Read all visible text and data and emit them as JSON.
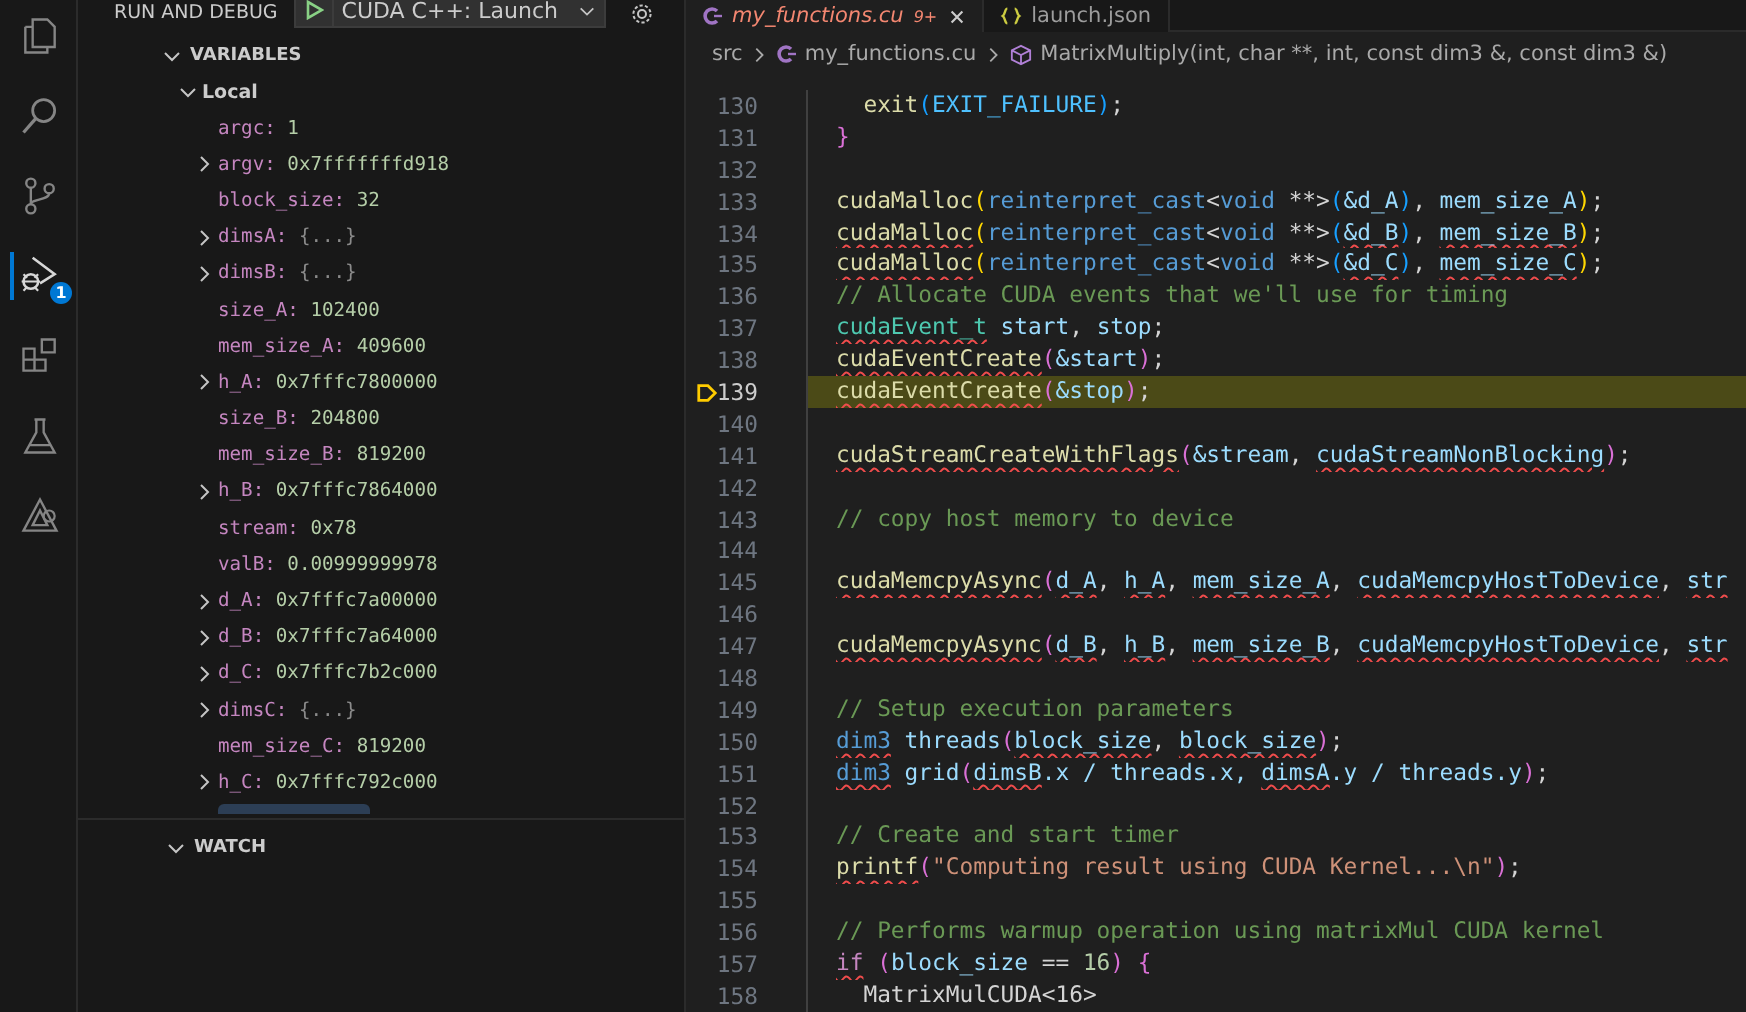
{
  "activity_bar": [
    {
      "kind": "files",
      "selected": false
    },
    {
      "kind": "search",
      "selected": false
    },
    {
      "kind": "source-control",
      "selected": false
    },
    {
      "kind": "debug",
      "selected": true,
      "badge": "1"
    },
    {
      "kind": "extensions",
      "selected": false
    },
    {
      "kind": "testing",
      "selected": false
    },
    {
      "kind": "cuda",
      "selected": false
    }
  ],
  "sidebar": {
    "title": "RUN AND DEBUG",
    "config": "CUDA C++: Launch",
    "variables": {
      "title": "VARIABLES",
      "expanded": true,
      "scope": {
        "label": "Local",
        "expanded": true,
        "items": [
          {
            "name": "argc:",
            "value": "1",
            "kind": "number",
            "expandable": false
          },
          {
            "name": "argv:",
            "value": "0x7fffffffd918",
            "kind": "number",
            "expandable": true
          },
          {
            "name": "block_size:",
            "value": "32",
            "kind": "number",
            "expandable": false
          },
          {
            "name": "dimsA:",
            "value": "{...}",
            "kind": "object",
            "expandable": true
          },
          {
            "name": "dimsB:",
            "value": "{...}",
            "kind": "object",
            "expandable": true
          },
          {
            "name": "size_A:",
            "value": "102400",
            "kind": "number",
            "expandable": false
          },
          {
            "name": "mem_size_A:",
            "value": "409600",
            "kind": "number",
            "expandable": false
          },
          {
            "name": "h_A:",
            "value": "0x7fffc7800000",
            "kind": "number",
            "expandable": true
          },
          {
            "name": "size_B:",
            "value": "204800",
            "kind": "number",
            "expandable": false
          },
          {
            "name": "mem_size_B:",
            "value": "819200",
            "kind": "number",
            "expandable": false
          },
          {
            "name": "h_B:",
            "value": "0x7fffc7864000",
            "kind": "number",
            "expandable": true
          },
          {
            "name": "stream:",
            "value": "0x78",
            "kind": "number",
            "expandable": false
          },
          {
            "name": "valB:",
            "value": "0.00999999978",
            "kind": "number",
            "expandable": false
          },
          {
            "name": "d_A:",
            "value": "0x7fffc7a00000",
            "kind": "number",
            "expandable": true
          },
          {
            "name": "d_B:",
            "value": "0x7fffc7a64000",
            "kind": "number",
            "expandable": true
          },
          {
            "name": "d_C:",
            "value": "0x7fffc7b2c000",
            "kind": "number",
            "expandable": true
          },
          {
            "name": "dimsC:",
            "value": "{...}",
            "kind": "object",
            "expandable": true
          },
          {
            "name": "mem_size_C:",
            "value": "819200",
            "kind": "number",
            "expandable": false
          },
          {
            "name": "h_C:",
            "value": "0x7fffc792c000",
            "kind": "number",
            "expandable": true
          }
        ]
      }
    },
    "watch": {
      "title": "WATCH",
      "expanded": true
    }
  },
  "tabs": [
    {
      "label": "my_functions.cu",
      "kind": "cpp",
      "selected": true,
      "problems": "9+"
    },
    {
      "label": "launch.json",
      "kind": "json",
      "selected": false
    }
  ],
  "breadcrumbs": [
    {
      "label": "src",
      "kind": "folder"
    },
    {
      "label": "my_functions.cu",
      "kind": "cpp"
    },
    {
      "label": "MatrixMultiply(int, char **, int, const dim3 &, const dim3 &)",
      "kind": "function"
    }
  ],
  "code": [
    {
      "number": "130",
      "current": false,
      "tokens": [
        {
          "kind": "fn",
          "text": "  exit",
          "error": false
        },
        {
          "kind": "b3",
          "text": "(",
          "error": false
        },
        {
          "kind": "const",
          "text": "EXIT_FAILURE",
          "error": false
        },
        {
          "kind": "b3",
          "text": ")",
          "error": false
        },
        {
          "kind": "plain",
          "text": ";",
          "error": false
        }
      ]
    },
    {
      "number": "131",
      "current": false,
      "tokens": [
        {
          "kind": "b2",
          "text": "}",
          "error": false
        }
      ]
    },
    {
      "number": "132",
      "current": false
    },
    {
      "number": "133",
      "current": false,
      "tokens": [
        {
          "kind": "fn",
          "text": "cudaMalloc",
          "error": false
        },
        {
          "kind": "b1",
          "text": "(",
          "error": false
        },
        {
          "kind": "kw",
          "text": "reinterpret_cast",
          "error": false
        },
        {
          "kind": "plain",
          "text": "<",
          "error": false
        },
        {
          "kind": "kw",
          "text": "void",
          "error": false
        },
        {
          "kind": "plain",
          "text": " **>",
          "error": false
        },
        {
          "kind": "b3",
          "text": "(",
          "error": false
        },
        {
          "kind": "var",
          "text": "&d_A",
          "error": false
        },
        {
          "kind": "b3",
          "text": ")",
          "error": false
        },
        {
          "kind": "plain",
          "text": ",",
          "error": false
        },
        {
          "kind": "var",
          "text": " mem_size_A",
          "error": false
        },
        {
          "kind": "b1",
          "text": ")",
          "error": false
        },
        {
          "kind": "plain",
          "text": ";",
          "error": false
        }
      ]
    },
    {
      "number": "134",
      "current": false,
      "tokens": [
        {
          "kind": "fn",
          "text": "cudaMalloc",
          "error": true
        },
        {
          "kind": "b1",
          "text": "(",
          "error": false
        },
        {
          "kind": "kw",
          "text": "reinterpret_cast",
          "error": false
        },
        {
          "kind": "plain",
          "text": "<",
          "error": false
        },
        {
          "kind": "kw",
          "text": "void",
          "error": false
        },
        {
          "kind": "plain",
          "text": " **>",
          "error": false
        },
        {
          "kind": "b3",
          "text": "(",
          "error": false
        },
        {
          "kind": "var",
          "text": "&d_B",
          "error": true
        },
        {
          "kind": "b3",
          "text": ")",
          "error": false
        },
        {
          "kind": "plain",
          "text": ", ",
          "error": false
        },
        {
          "kind": "var",
          "text": "mem_size_B",
          "error": true
        },
        {
          "kind": "b1",
          "text": ")",
          "error": false
        },
        {
          "kind": "plain",
          "text": ";",
          "error": false
        }
      ]
    },
    {
      "number": "135",
      "current": false,
      "tokens": [
        {
          "kind": "fn",
          "text": "cudaMalloc",
          "error": true
        },
        {
          "kind": "b1",
          "text": "(",
          "error": false
        },
        {
          "kind": "kw",
          "text": "reinterpret_cast",
          "error": false
        },
        {
          "kind": "plain",
          "text": "<",
          "error": false
        },
        {
          "kind": "kw",
          "text": "void",
          "error": false
        },
        {
          "kind": "plain",
          "text": " **>",
          "error": false
        },
        {
          "kind": "b3",
          "text": "(",
          "error": false
        },
        {
          "kind": "var",
          "text": "&d_C",
          "error": true
        },
        {
          "kind": "b3",
          "text": ")",
          "error": false
        },
        {
          "kind": "plain",
          "text": ", ",
          "error": false
        },
        {
          "kind": "var",
          "text": "mem_size_C",
          "error": true
        },
        {
          "kind": "b1",
          "text": ")",
          "error": false
        },
        {
          "kind": "plain",
          "text": ";",
          "error": false
        }
      ]
    },
    {
      "number": "136",
      "current": false,
      "tokens": [
        {
          "kind": "comment",
          "text": "// Allocate CUDA events that we'll use for timing",
          "error": false
        }
      ]
    },
    {
      "number": "137",
      "current": false,
      "tokens": [
        {
          "kind": "type",
          "text": "cudaEvent_t",
          "error": true
        },
        {
          "kind": "var",
          "text": " start",
          "error": false
        },
        {
          "kind": "plain",
          "text": ", ",
          "error": false
        },
        {
          "kind": "var",
          "text": "stop",
          "error": false
        },
        {
          "kind": "plain",
          "text": ";",
          "error": false
        }
      ]
    },
    {
      "number": "138",
      "current": false,
      "tokens": [
        {
          "kind": "fn",
          "text": "cudaEventCreate",
          "error": true
        },
        {
          "kind": "b2",
          "text": "(",
          "error": false
        },
        {
          "kind": "var",
          "text": "&start",
          "error": false
        },
        {
          "kind": "b2",
          "text": ")",
          "error": false
        },
        {
          "kind": "plain",
          "text": ";",
          "error": false
        }
      ]
    },
    {
      "number": "139",
      "current": true,
      "tokens": [
        {
          "kind": "fn",
          "text": "cudaEventCreate",
          "error": true
        },
        {
          "kind": "b2",
          "text": "(",
          "error": false
        },
        {
          "kind": "var",
          "text": "&stop",
          "error": false
        },
        {
          "kind": "b2",
          "text": ")",
          "error": false
        },
        {
          "kind": "plain",
          "text": ";",
          "error": false
        }
      ]
    },
    {
      "number": "140",
      "current": false
    },
    {
      "number": "141",
      "current": false,
      "tokens": [
        {
          "kind": "fn",
          "text": "cudaStreamCreateWithFlags",
          "error": true
        },
        {
          "kind": "b2",
          "text": "(",
          "error": false
        },
        {
          "kind": "var",
          "text": "&stream",
          "error": false
        },
        {
          "kind": "plain",
          "text": ", ",
          "error": false
        },
        {
          "kind": "var",
          "text": "cudaStreamNonBlocking",
          "error": true
        },
        {
          "kind": "b2",
          "text": ")",
          "error": false
        },
        {
          "kind": "plain",
          "text": ";",
          "error": false
        }
      ]
    },
    {
      "number": "142",
      "current": false
    },
    {
      "number": "143",
      "current": false,
      "tokens": [
        {
          "kind": "comment",
          "text": "// copy host memory to device",
          "error": false
        }
      ]
    },
    {
      "number": "144",
      "current": false
    },
    {
      "number": "145",
      "current": false,
      "tokens": [
        {
          "kind": "fn",
          "text": "cudaMemcpyAsync",
          "error": true
        },
        {
          "kind": "b2",
          "text": "(",
          "error": false
        },
        {
          "kind": "var",
          "text": "d_A",
          "error": true
        },
        {
          "kind": "plain",
          "text": ", ",
          "error": false
        },
        {
          "kind": "var",
          "text": "h_A",
          "error": true
        },
        {
          "kind": "plain",
          "text": ", ",
          "error": false
        },
        {
          "kind": "var",
          "text": "mem_size_A",
          "error": true
        },
        {
          "kind": "plain",
          "text": ", ",
          "error": false
        },
        {
          "kind": "var",
          "text": "cudaMemcpyHostToDevice",
          "error": true
        },
        {
          "kind": "plain",
          "text": ", ",
          "error": false
        },
        {
          "kind": "var",
          "text": "str",
          "error": true
        }
      ]
    },
    {
      "number": "146",
      "current": false
    },
    {
      "number": "147",
      "current": false,
      "tokens": [
        {
          "kind": "fn",
          "text": "cudaMemcpyAsync",
          "error": true
        },
        {
          "kind": "b2",
          "text": "(",
          "error": false
        },
        {
          "kind": "var",
          "text": "d_B",
          "error": true
        },
        {
          "kind": "plain",
          "text": ", ",
          "error": false
        },
        {
          "kind": "var",
          "text": "h_B",
          "error": true
        },
        {
          "kind": "plain",
          "text": ", ",
          "error": false
        },
        {
          "kind": "var",
          "text": "mem_size_B",
          "error": true
        },
        {
          "kind": "plain",
          "text": ", ",
          "error": false
        },
        {
          "kind": "var",
          "text": "cudaMemcpyHostToDevice",
          "error": true
        },
        {
          "kind": "plain",
          "text": ", ",
          "error": false
        },
        {
          "kind": "var",
          "text": "str",
          "error": true
        }
      ]
    },
    {
      "number": "148",
      "current": false
    },
    {
      "number": "149",
      "current": false,
      "tokens": [
        {
          "kind": "comment",
          "text": "// Setup execution parameters",
          "error": false
        }
      ]
    },
    {
      "number": "150",
      "current": false,
      "tokens": [
        {
          "kind": "kw",
          "text": "dim3",
          "error": true
        },
        {
          "kind": "var",
          "text": " threads",
          "error": false
        },
        {
          "kind": "b2",
          "text": "(",
          "error": false
        },
        {
          "kind": "var",
          "text": "block_size",
          "error": true
        },
        {
          "kind": "plain",
          "text": ", ",
          "error": false
        },
        {
          "kind": "var",
          "text": "block_size",
          "error": true
        },
        {
          "kind": "b2",
          "text": ")",
          "error": false
        },
        {
          "kind": "plain",
          "text": ";",
          "error": false
        }
      ]
    },
    {
      "number": "151",
      "current": false,
      "tokens": [
        {
          "kind": "kw",
          "text": "dim3",
          "error": true
        },
        {
          "kind": "var",
          "text": " grid",
          "error": false
        },
        {
          "kind": "b2",
          "text": "(",
          "error": false
        },
        {
          "kind": "var",
          "text": "dimsB",
          "error": true
        },
        {
          "kind": "var",
          "text": ".x / threads.x, ",
          "error": false
        },
        {
          "kind": "var",
          "text": "dimsA",
          "error": true
        },
        {
          "kind": "var",
          "text": ".y / threads.y",
          "error": false
        },
        {
          "kind": "b2",
          "text": ")",
          "error": false
        },
        {
          "kind": "plain",
          "text": ";",
          "error": false
        }
      ]
    },
    {
      "number": "152",
      "current": false
    },
    {
      "number": "153",
      "current": false,
      "tokens": [
        {
          "kind": "comment",
          "text": "// Create and start timer",
          "error": false
        }
      ]
    },
    {
      "number": "154",
      "current": false,
      "tokens": [
        {
          "kind": "fn",
          "text": "printf",
          "error": true
        },
        {
          "kind": "b2",
          "text": "(",
          "error": false
        },
        {
          "kind": "str",
          "text": "\"Computing result using CUDA Kernel...\\n\"",
          "error": false
        },
        {
          "kind": "b2",
          "text": ")",
          "error": false
        },
        {
          "kind": "plain",
          "text": ";",
          "error": false
        }
      ]
    },
    {
      "number": "155",
      "current": false
    },
    {
      "number": "156",
      "current": false,
      "tokens": [
        {
          "kind": "comment",
          "text": "// Performs warmup operation using matrixMul CUDA kernel",
          "error": false
        }
      ]
    },
    {
      "number": "157",
      "current": false,
      "tokens": [
        {
          "kind": "control",
          "text": "if",
          "error": true
        },
        {
          "kind": "b2",
          "text": " (",
          "error": false
        },
        {
          "kind": "var",
          "text": "block_size",
          "error": false
        },
        {
          "kind": "plain",
          "text": " == ",
          "error": false
        },
        {
          "kind": "num",
          "text": "16",
          "error": false
        },
        {
          "kind": "b2",
          "text": ")",
          "error": false
        },
        {
          "kind": "b2",
          "text": " {",
          "error": false
        }
      ]
    },
    {
      "number": "158",
      "current": false,
      "tokens": [
        {
          "kind": "plain",
          "text": "  MatrixMulCUDA<16>",
          "error": false
        }
      ]
    }
  ]
}
